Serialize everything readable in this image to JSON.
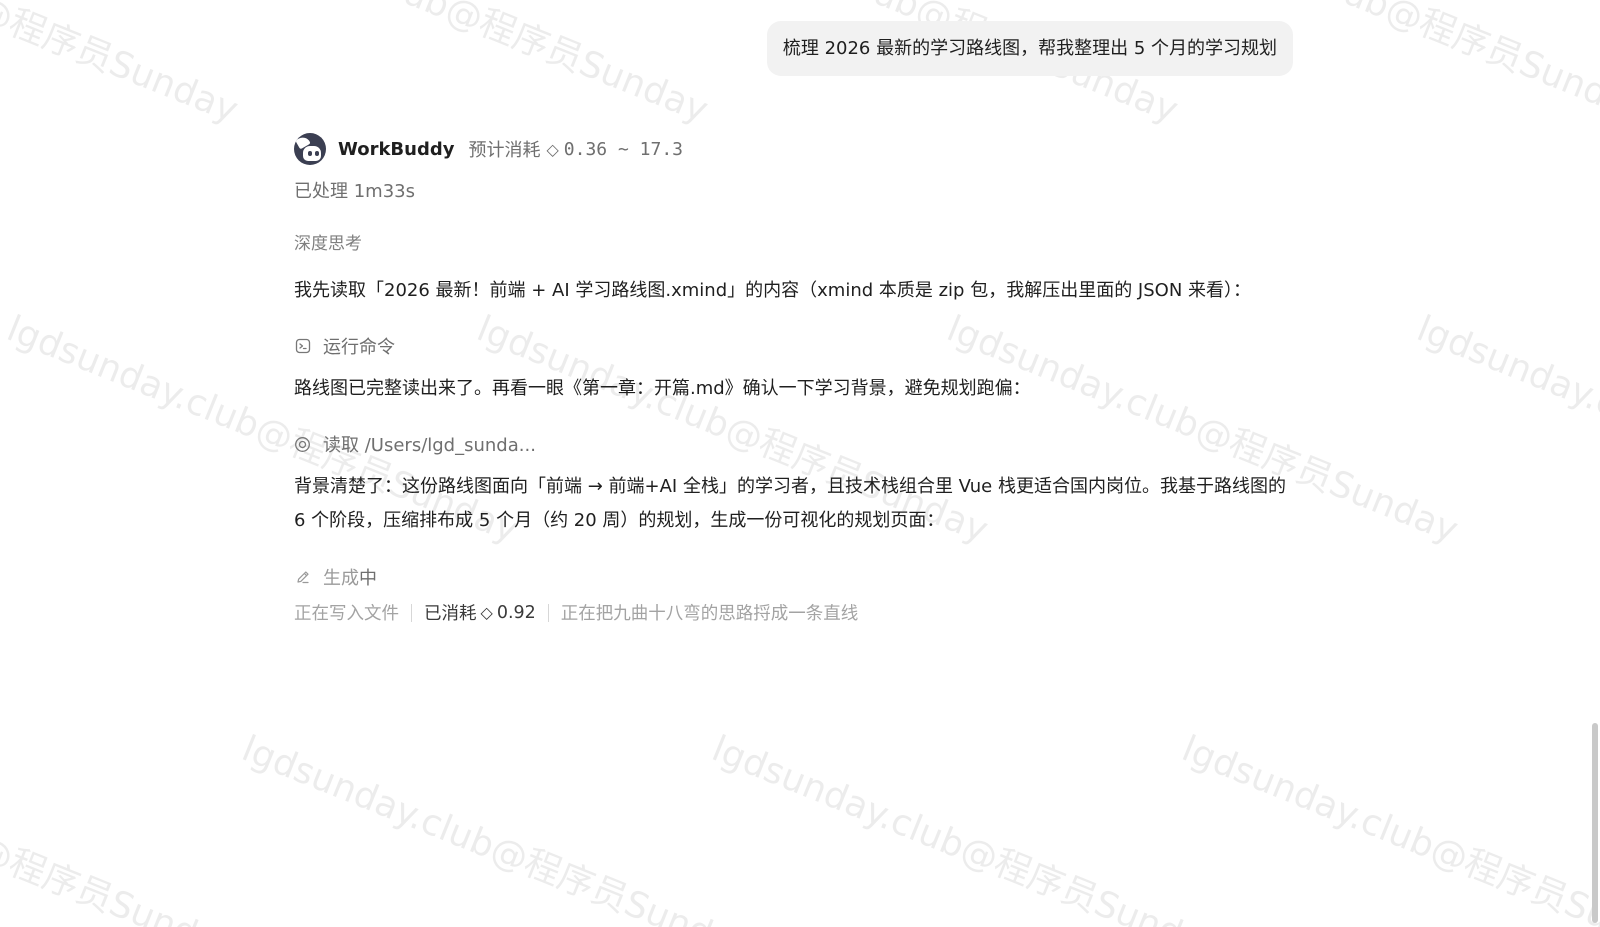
{
  "user_message": "梳理 2026 最新的学习路线图，帮我整理出 5 个月的学习规划",
  "assistant": {
    "name": "WorkBuddy",
    "cost_label": "预计消耗",
    "cost_icon": "diamond-icon",
    "cost_range": "0.36 ~ 17.3",
    "processed": "已处理 1m33s",
    "deep_think": "深度思考",
    "messages": [
      "我先读取「2026 最新！前端 + AI 学习路线图.xmind」的内容（xmind 本质是 zip 包，我解压出里面的 JSON 来看）：",
      "路线图已完整读出来了。再看一眼《第一章：开篇.md》确认一下学习背景，避免规划跑偏：",
      "背景清楚了：这份路线图面向「前端 → 前端+AI 全栈」的学习者，且技术栈组合里 Vue 栈更适合国内岗位。我基于路线图的 6 个阶段，压缩排布成 5 个月（约 20 周）的规划，生成一份可视化的规划页面："
    ],
    "tools": {
      "run_command": "运行命令",
      "read_file": "读取 /Users/lgd_sunda...",
      "generating_prefix": "生成",
      "generating_suffix": "中"
    },
    "status": {
      "writing": "正在写入文件",
      "spent_label": "已消耗",
      "spent_value": "0.92",
      "thinking": "正在把九曲十八弯的思路捋成一条直线"
    }
  },
  "watermark": {
    "text": "lgdsunday.club@程序员Sunday"
  }
}
